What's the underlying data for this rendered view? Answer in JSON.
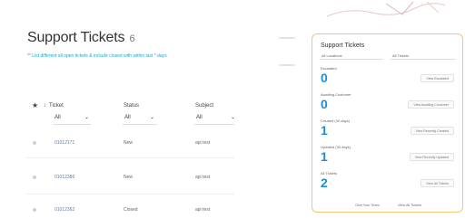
{
  "left": {
    "title": "Support Tickets",
    "count": "6",
    "subtitle": "** List different all open tickets & include closed with within last * days",
    "columns": [
      "Ticket",
      "Status",
      "Subject"
    ],
    "filters": [
      "All",
      "All",
      "All"
    ],
    "rows": [
      {
        "ticket": "01012171",
        "status": "New",
        "subject": "api test"
      },
      {
        "ticket": "01012386",
        "status": "New",
        "subject": "api test"
      },
      {
        "ticket": "01012362",
        "status": "Closed",
        "subject": "api test"
      }
    ]
  },
  "right": {
    "title": "Support Tickets",
    "select1": "All Locations",
    "select2": "All Tickets",
    "stats": [
      {
        "label": "Escalated",
        "value": "0",
        "button": "View Escalated"
      },
      {
        "label": "Awaiting Customer",
        "value": "0",
        "button": "View Awaiting Customer"
      },
      {
        "label": "Created (30 days)",
        "value": "1",
        "button": "View Recently Created"
      },
      {
        "label": "Updated (30 days)",
        "value": "1",
        "button": "View Recently Updated"
      },
      {
        "label": "All Tickets",
        "value": "2",
        "button": "View All Tickets"
      }
    ],
    "footer": [
      "Give Your Team",
      "View All Tickets"
    ]
  },
  "colors": {
    "accent": "#1d8fcf",
    "card_border": "#f1c873",
    "link": "#1aa7c9"
  }
}
